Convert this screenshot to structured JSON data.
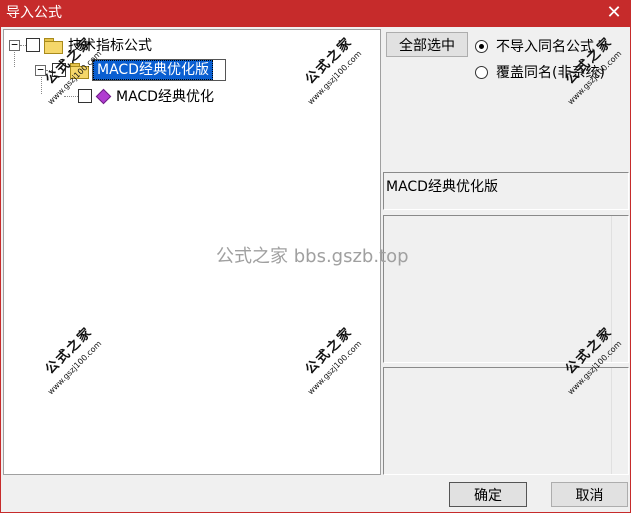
{
  "window": {
    "title": "导入公式",
    "close_glyph": "✕"
  },
  "tree": {
    "root": {
      "label": "技术指标公式",
      "expander": "−"
    },
    "group": {
      "label": "MACD经典优化版",
      "expander": "−"
    },
    "leaf": {
      "label": "MACD经典优化"
    }
  },
  "right": {
    "select_all_label": "全部选中",
    "options": [
      {
        "label": "不导入同名公式",
        "checked": true
      },
      {
        "label": "覆盖同名(非系统)",
        "checked": false
      }
    ],
    "detail_name": "MACD经典优化版"
  },
  "footer": {
    "ok_label": "确定",
    "cancel_label": "取消"
  },
  "watermark": {
    "center_text": "公式之家 bbs.gszb.top",
    "stamp_text": "公式之家",
    "stamp_url": "www.gszj100.com"
  },
  "colors": {
    "titlebar": "#c62b2b",
    "selection": "#0a5fd1"
  }
}
